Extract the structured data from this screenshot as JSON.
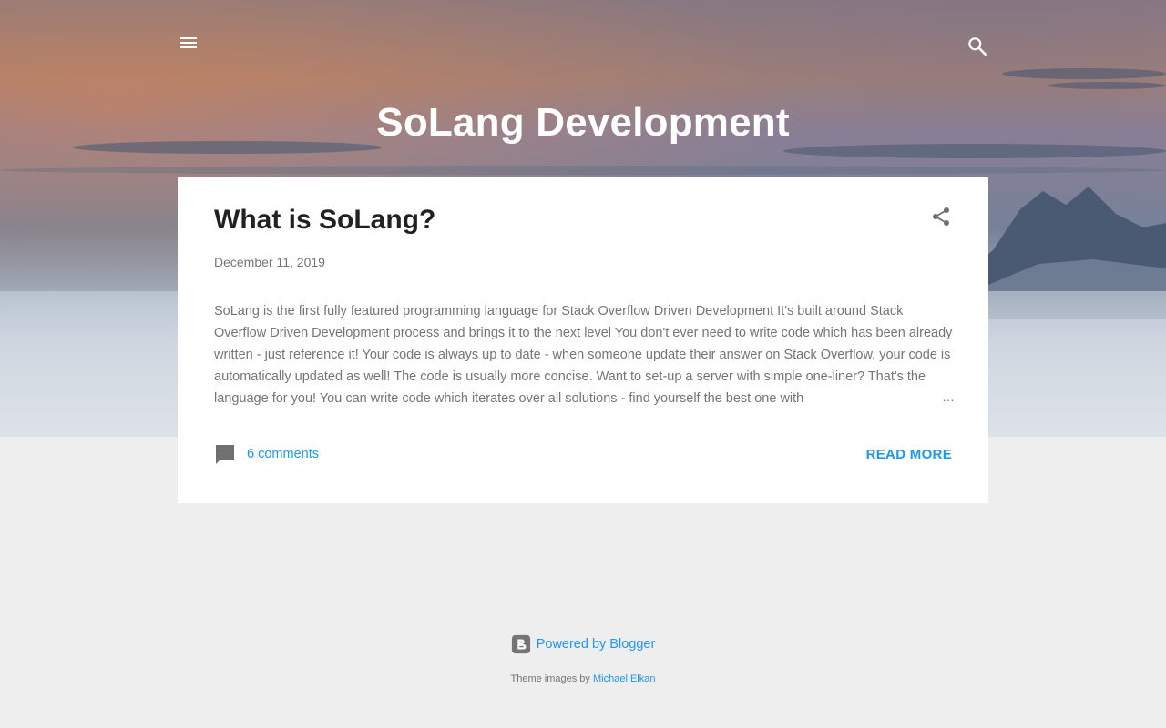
{
  "blog": {
    "title": "SoLang Development"
  },
  "post": {
    "title": "What is SoLang?",
    "date": "December 11, 2019",
    "snippet": "SoLang is the first fully featured programming language for Stack Overflow Driven Development It's built around Stack Overflow Driven Development process and brings it to the next level You don't ever need to write code which has been already written - just reference it! Your code is always up to date - when someone update their answer on Stack Overflow, your code is automatically updated as well! The code is usually more concise. Want to set-up a server with simple one-liner? That's the language for you! You can write code which iterates over all solutions - find yourself the best one with",
    "ellipsis": "…",
    "comments": "6 comments",
    "read_more": "READ MORE"
  },
  "footer": {
    "powered_by": "Powered by Blogger",
    "theme_prefix": "Theme images by",
    "theme_author": "Michael Elkan"
  },
  "icons": {
    "menu": "hamburger-menu-icon",
    "search": "search-icon",
    "share": "share-icon",
    "comment": "comment-icon",
    "blogger": "blogger-icon"
  },
  "colors": {
    "accent": "#2196f3",
    "title_text": "#212121",
    "body_text": "#757575",
    "page_bg": "#eeeeee",
    "icon_gray": "#707070"
  }
}
